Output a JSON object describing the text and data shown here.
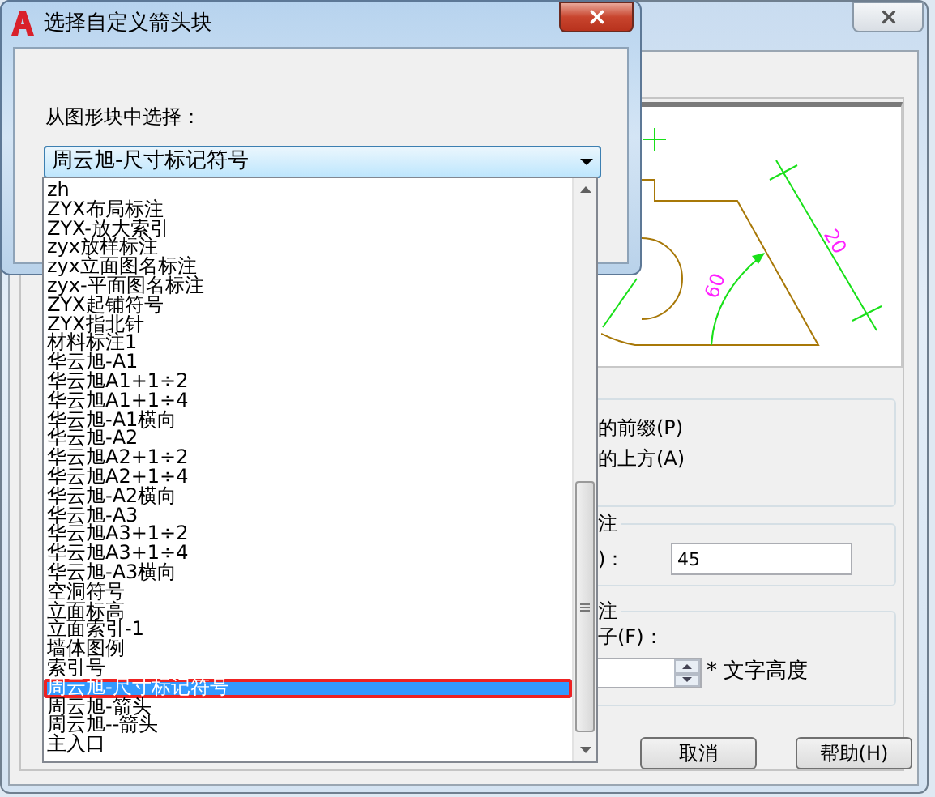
{
  "background_dialog": {
    "preview": {
      "labels": [
        "60",
        "20"
      ]
    },
    "options": [
      {
        "label": "的前缀(P)"
      },
      {
        "label": "的上方(A)"
      }
    ],
    "angle_group": {
      "title": "注",
      "label": ")：",
      "value": "45"
    },
    "scale_group": {
      "title": "注",
      "label": "子(F)：",
      "suffix": "* 文字高度"
    },
    "buttons": [
      "取消",
      "帮助(H)"
    ]
  },
  "dialog": {
    "title": "选择自定义箭头块",
    "label": "从图形块中选择：",
    "combo": {
      "value": "周云旭-尺寸标记符号"
    },
    "list": [
      {
        "label": "zh",
        "selected": false
      },
      {
        "label": "ZYX布局标注",
        "selected": false
      },
      {
        "label": "ZYX-放大索引",
        "selected": false
      },
      {
        "label": "zyx放样标注",
        "selected": false
      },
      {
        "label": "zyx立面图名标注",
        "selected": false
      },
      {
        "label": "zyx-平面图名标注",
        "selected": false
      },
      {
        "label": "ZYX起铺符号",
        "selected": false
      },
      {
        "label": "ZYX指北针",
        "selected": false
      },
      {
        "label": "材料标注1",
        "selected": false
      },
      {
        "label": "华云旭-A1",
        "selected": false
      },
      {
        "label": "华云旭A1+1÷2",
        "selected": false
      },
      {
        "label": "华云旭A1+1÷4",
        "selected": false
      },
      {
        "label": "华云旭-A1横向",
        "selected": false
      },
      {
        "label": "华云旭-A2",
        "selected": false
      },
      {
        "label": "华云旭A2+1÷2",
        "selected": false
      },
      {
        "label": "华云旭A2+1÷4",
        "selected": false
      },
      {
        "label": "华云旭-A2横向",
        "selected": false
      },
      {
        "label": "华云旭-A3",
        "selected": false
      },
      {
        "label": "华云旭A3+1÷2",
        "selected": false
      },
      {
        "label": "华云旭A3+1÷4",
        "selected": false
      },
      {
        "label": "华云旭-A3横向",
        "selected": false
      },
      {
        "label": "空洞符号",
        "selected": false
      },
      {
        "label": "立面标高",
        "selected": false
      },
      {
        "label": "立面索引-1",
        "selected": false
      },
      {
        "label": "墙体图例",
        "selected": false
      },
      {
        "label": "索引号",
        "selected": false
      },
      {
        "label": "周云旭-尺寸标记符号",
        "selected": true
      },
      {
        "label": "周云旭-箭头",
        "selected": false
      },
      {
        "label": "周云旭--箭头",
        "selected": false
      },
      {
        "label": "主入口",
        "selected": false
      }
    ]
  }
}
